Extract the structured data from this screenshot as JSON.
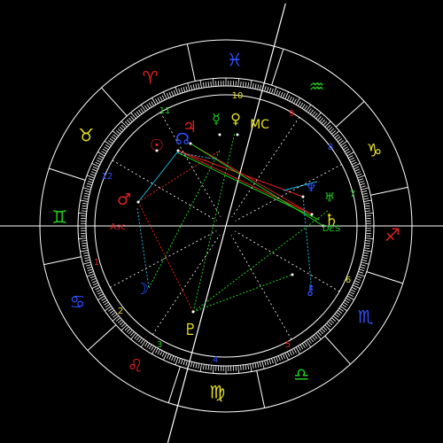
{
  "signs": [
    {
      "name": "aries",
      "glyph": "♈",
      "color": "#e02020"
    },
    {
      "name": "taurus",
      "glyph": "♉",
      "color": "#e8e020"
    },
    {
      "name": "gemini",
      "glyph": "♊",
      "color": "#20d020"
    },
    {
      "name": "cancer",
      "glyph": "♋",
      "color": "#3050ff"
    },
    {
      "name": "leo",
      "glyph": "♌",
      "color": "#e02020"
    },
    {
      "name": "virgo",
      "glyph": "♍",
      "color": "#e8e020"
    },
    {
      "name": "libra",
      "glyph": "♎",
      "color": "#20d020"
    },
    {
      "name": "scorpio",
      "glyph": "♏",
      "color": "#3050ff"
    },
    {
      "name": "sagittarius",
      "glyph": "♐",
      "color": "#e02020"
    },
    {
      "name": "capricorn",
      "glyph": "♑",
      "color": "#e8e020"
    },
    {
      "name": "aquarius",
      "glyph": "♒",
      "color": "#20d020"
    },
    {
      "name": "pisces",
      "glyph": "♓",
      "color": "#3050ff"
    }
  ],
  "houses": [
    "1",
    "2",
    "3",
    "4",
    "5",
    "6",
    "7",
    "8",
    "9",
    "10",
    "11",
    "12"
  ],
  "angles": {
    "asc": "Asc",
    "des": "DES",
    "mc": "MC"
  },
  "planets": [
    {
      "name": "sun",
      "glyph": "☉",
      "color": "#e02020"
    },
    {
      "name": "moon",
      "glyph": "☽",
      "color": "#3050ff"
    },
    {
      "name": "mercury",
      "glyph": "☿",
      "color": "#20d020"
    },
    {
      "name": "venus",
      "glyph": "♀",
      "color": "#e8e020"
    },
    {
      "name": "mars",
      "glyph": "♂",
      "color": "#e02020"
    },
    {
      "name": "jupiter",
      "glyph": "♃",
      "color": "#e02020"
    },
    {
      "name": "saturn",
      "glyph": "♄",
      "color": "#e8e020"
    },
    {
      "name": "uranus",
      "glyph": "♅",
      "color": "#20d020"
    },
    {
      "name": "neptune",
      "glyph": "♆",
      "color": "#3050ff"
    },
    {
      "name": "pluto",
      "glyph": "♇",
      "color": "#e8e020"
    },
    {
      "name": "north-node",
      "glyph": "☊",
      "color": "#3050ff"
    },
    {
      "name": "chiron",
      "glyph": "⚷",
      "color": "#3050ff"
    }
  ],
  "colors": {
    "background": "#000000",
    "wheel": "#ffffff",
    "aspect_red": "#e02020",
    "aspect_green": "#20d020",
    "aspect_blue": "#20b8e0"
  }
}
